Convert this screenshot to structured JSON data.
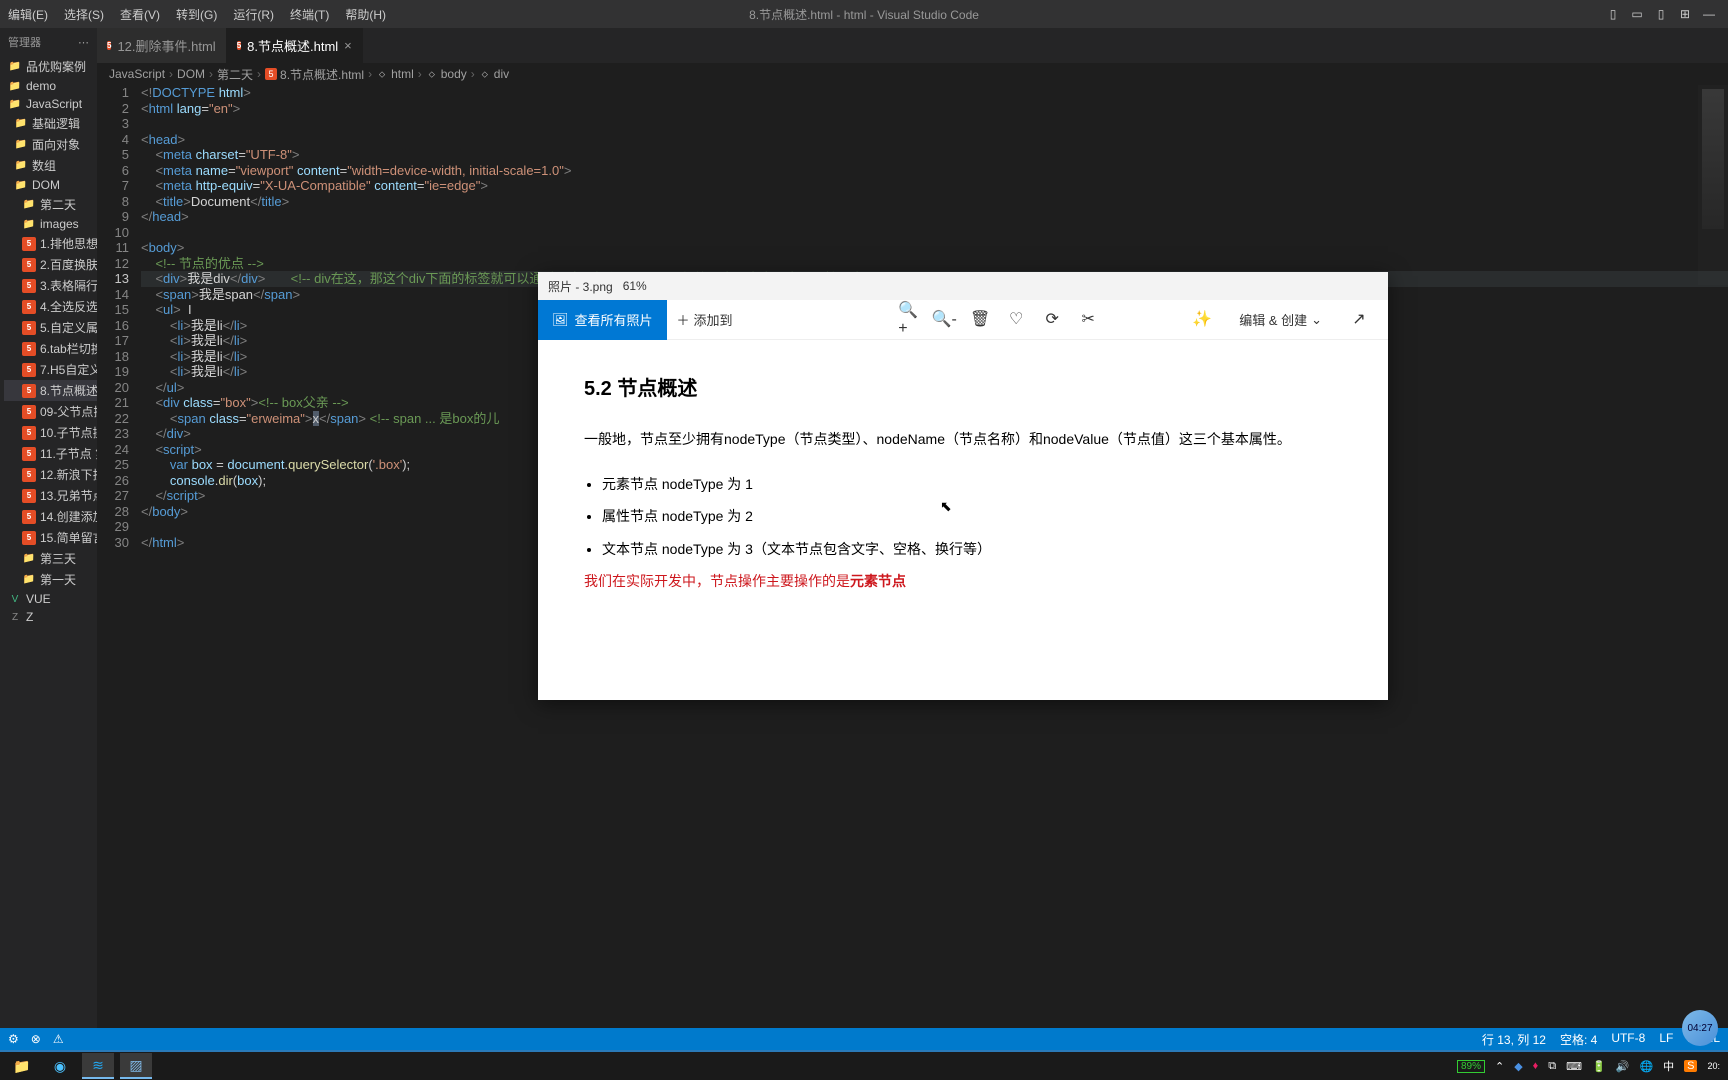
{
  "menubar": {
    "items": [
      "编辑(E)",
      "选择(S)",
      "查看(V)",
      "转到(G)",
      "运行(R)",
      "终端(T)",
      "帮助(H)"
    ],
    "title": "8.节点概述.html - html - Visual Studio Code"
  },
  "sidebar": {
    "header": "管理器",
    "items": [
      {
        "label": "品优购案例",
        "icon": "folder"
      },
      {
        "label": "demo",
        "icon": "folder"
      },
      {
        "label": "JavaScript",
        "icon": "folder"
      },
      {
        "label": "基础逻辑",
        "icon": "folder",
        "indent": 1
      },
      {
        "label": "面向对象",
        "icon": "folder",
        "indent": 1
      },
      {
        "label": "数组",
        "icon": "folder",
        "indent": 1
      },
      {
        "label": "DOM",
        "icon": "folder",
        "indent": 1
      },
      {
        "label": "第二天",
        "icon": "folder",
        "indent": 2
      },
      {
        "label": "images",
        "icon": "folder",
        "indent": 2
      },
      {
        "label": "1.排他思想.ht...",
        "icon": "html5",
        "indent": 2
      },
      {
        "label": "2.百度换肤效...",
        "icon": "html5",
        "indent": 2
      },
      {
        "label": "3.表格隔行变...",
        "icon": "html5",
        "indent": 2
      },
      {
        "label": "4.全选反选.ht...",
        "icon": "html5",
        "indent": 2
      },
      {
        "label": "5.自定义属性...",
        "icon": "html5",
        "indent": 2
      },
      {
        "label": "6.tab栏切换.h...",
        "icon": "html5",
        "indent": 2
      },
      {
        "label": "7.H5自定义属...",
        "icon": "html5",
        "indent": 2
      },
      {
        "label": "8.节点概述.ht...",
        "icon": "html5",
        "indent": 2,
        "selected": true
      },
      {
        "label": "09-父节点操...",
        "icon": "html5",
        "indent": 2
      },
      {
        "label": "10.子节点操...",
        "icon": "html5",
        "indent": 2
      },
      {
        "label": "11.子节点 第...",
        "icon": "html5",
        "indent": 2
      },
      {
        "label": "12.新浪下拉...",
        "icon": "html5",
        "indent": 2
      },
      {
        "label": "13.兄弟节点.h...",
        "icon": "html5",
        "indent": 2
      },
      {
        "label": "14.创建添加...",
        "icon": "html5",
        "indent": 2
      },
      {
        "label": "15.简单留言...",
        "icon": "html5",
        "indent": 2
      },
      {
        "label": "第三天",
        "icon": "folder",
        "indent": 2
      },
      {
        "label": "第一天",
        "icon": "folder",
        "indent": 2
      },
      {
        "label": "VUE",
        "icon": "vue"
      },
      {
        "label": "Z",
        "icon": "z"
      }
    ]
  },
  "tabs": [
    {
      "label": "12.删除事件.html"
    },
    {
      "label": "8.节点概述.html",
      "active": true
    }
  ],
  "breadcrumb": [
    "JavaScript",
    "DOM",
    "第二天",
    "8.节点概述.html",
    "html",
    "body",
    "div"
  ],
  "code": {
    "lines": [
      {
        "n": 1,
        "html": "<span class='t-punc'>&lt;!</span><span class='t-tag'>DOCTYPE</span> <span class='t-attr'>html</span><span class='t-punc'>&gt;</span>"
      },
      {
        "n": 2,
        "html": "<span class='t-punc'>&lt;</span><span class='t-tag'>html</span> <span class='t-attr'>lang</span>=<span class='t-str'>\"en\"</span><span class='t-punc'>&gt;</span>"
      },
      {
        "n": 3,
        "html": ""
      },
      {
        "n": 4,
        "html": "<span class='t-punc'>&lt;</span><span class='t-tag'>head</span><span class='t-punc'>&gt;</span>"
      },
      {
        "n": 5,
        "html": "    <span class='t-punc'>&lt;</span><span class='t-tag'>meta</span> <span class='t-attr'>charset</span>=<span class='t-str'>\"UTF-8\"</span><span class='t-punc'>&gt;</span>"
      },
      {
        "n": 6,
        "html": "    <span class='t-punc'>&lt;</span><span class='t-tag'>meta</span> <span class='t-attr'>name</span>=<span class='t-str'>\"viewport\"</span> <span class='t-attr'>content</span>=<span class='t-str'>\"width=device-width, initial-scale=1.0\"</span><span class='t-punc'>&gt;</span>"
      },
      {
        "n": 7,
        "html": "    <span class='t-punc'>&lt;</span><span class='t-tag'>meta</span> <span class='t-attr'>http-equiv</span>=<span class='t-str'>\"X-UA-Compatible\"</span> <span class='t-attr'>content</span>=<span class='t-str'>\"ie=edge\"</span><span class='t-punc'>&gt;</span>"
      },
      {
        "n": 8,
        "html": "    <span class='t-punc'>&lt;</span><span class='t-tag'>title</span><span class='t-punc'>&gt;</span><span class='t-text'>Document</span><span class='t-punc'>&lt;/</span><span class='t-tag'>title</span><span class='t-punc'>&gt;</span>"
      },
      {
        "n": 9,
        "html": "<span class='t-punc'>&lt;/</span><span class='t-tag'>head</span><span class='t-punc'>&gt;</span>"
      },
      {
        "n": 10,
        "html": ""
      },
      {
        "n": 11,
        "html": "<span class='t-punc'>&lt;</span><span class='t-tag'>body</span><span class='t-punc'>&gt;</span>"
      },
      {
        "n": 12,
        "html": "    <span class='t-cmt'>&lt;!-- 节点的优点 --&gt;</span>"
      },
      {
        "n": 13,
        "hl": true,
        "html": "    <span class='t-punc'>&lt;</span><span class='t-tag'>div</span><span class='t-punc'>&gt;</span><span class='t-text'>我是div</span><span class='t-punc'>&lt;/</span><span class='t-tag'>div</span><span class='t-punc'>&gt;</span>       <span class='t-cmt'>&lt;!-- div在这，那这个div下面的标签就可以通过节点来操作 --&gt;</span>      <span class='t-cmt'>&lt;!--标签节点、文本节点、属性节点--&gt;</span>"
      },
      {
        "n": 14,
        "html": "    <span class='t-punc'>&lt;</span><span class='t-tag'>span</span><span class='t-punc'>&gt;</span><span class='t-text'>我是span</span><span class='t-punc'>&lt;/</span><span class='t-tag'>span</span><span class='t-punc'>&gt;</span>"
      },
      {
        "n": 15,
        "html": "    <span class='t-punc'>&lt;</span><span class='t-tag'>ul</span><span class='t-punc'>&gt;</span>  <span class='t-text'>I</span>"
      },
      {
        "n": 16,
        "html": "        <span class='t-punc'>&lt;</span><span class='t-tag'>li</span><span class='t-punc'>&gt;</span><span class='t-text'>我是li</span><span class='t-punc'>&lt;/</span><span class='t-tag'>li</span><span class='t-punc'>&gt;</span>"
      },
      {
        "n": 17,
        "html": "        <span class='t-punc'>&lt;</span><span class='t-tag'>li</span><span class='t-punc'>&gt;</span><span class='t-text'>我是li</span><span class='t-punc'>&lt;/</span><span class='t-tag'>li</span><span class='t-punc'>&gt;</span>"
      },
      {
        "n": 18,
        "html": "        <span class='t-punc'>&lt;</span><span class='t-tag'>li</span><span class='t-punc'>&gt;</span><span class='t-text'>我是li</span><span class='t-punc'>&lt;/</span><span class='t-tag'>li</span><span class='t-punc'>&gt;</span>"
      },
      {
        "n": 19,
        "html": "        <span class='t-punc'>&lt;</span><span class='t-tag'>li</span><span class='t-punc'>&gt;</span><span class='t-text'>我是li</span><span class='t-punc'>&lt;/</span><span class='t-tag'>li</span><span class='t-punc'>&gt;</span>"
      },
      {
        "n": 20,
        "html": "    <span class='t-punc'>&lt;/</span><span class='t-tag'>ul</span><span class='t-punc'>&gt;</span>"
      },
      {
        "n": 21,
        "html": "    <span class='t-punc'>&lt;</span><span class='t-tag'>div</span> <span class='t-attr'>class</span>=<span class='t-str'>\"box\"</span><span class='t-punc'>&gt;</span><span class='t-cmt'>&lt;!-- box父亲 --&gt;</span>"
      },
      {
        "n": 22,
        "html": "        <span class='t-punc'>&lt;</span><span class='t-tag'>span</span> <span class='t-attr'>class</span>=<span class='t-str'>\"erweima\"</span><span class='t-punc'>&gt;</span><span class='cursor-mark'>x</span><span class='t-punc'>&lt;/</span><span class='t-tag'>span</span><span class='t-punc'>&gt;</span> <span class='t-cmt'>&lt;!-- span ... 是box的儿</span>"
      },
      {
        "n": 23,
        "html": "    <span class='t-punc'>&lt;/</span><span class='t-tag'>div</span><span class='t-punc'>&gt;</span>"
      },
      {
        "n": 24,
        "html": "    <span class='t-punc'>&lt;</span><span class='t-tag'>script</span><span class='t-punc'>&gt;</span>"
      },
      {
        "n": 25,
        "html": "        <span class='t-kw'>var</span> <span class='t-var'>box</span> = <span class='t-var'>document</span>.<span class='t-fn'>querySelector</span>(<span class='t-str'>'.box'</span>);"
      },
      {
        "n": 26,
        "html": "        <span class='t-var'>console</span>.<span class='t-fn'>dir</span>(<span class='t-var'>box</span>);"
      },
      {
        "n": 27,
        "html": "    <span class='t-punc'>&lt;/</span><span class='t-tag'>script</span><span class='t-punc'>&gt;</span>"
      },
      {
        "n": 28,
        "html": "<span class='t-punc'>&lt;/</span><span class='t-tag'>body</span><span class='t-punc'>&gt;</span>"
      },
      {
        "n": 29,
        "html": ""
      },
      {
        "n": 30,
        "html": "<span class='t-punc'>&lt;/</span><span class='t-tag'>html</span><span class='t-punc'>&gt;</span>"
      }
    ]
  },
  "photos": {
    "title": "照片 - 3.png",
    "zoom": "61%",
    "see_all": "查看所有照片",
    "add_to": "添加到",
    "edit_create": "编辑 & 创建",
    "heading": "5.2 节点概述",
    "para": "一般地，节点至少拥有nodeType（节点类型）、nodeName（节点名称）和nodeValue（节点值）这三个基本属性。",
    "bullets": [
      "元素节点 nodeType 为 1",
      "属性节点 nodeType 为 2",
      "文本节点 nodeType 为 3（文本节点包含文字、空格、换行等）"
    ],
    "red_prefix": "我们在实际开发中，节点操作主要操作的是",
    "red_bold": "元素节点"
  },
  "status": {
    "left_icons": [
      "⊗",
      "⚠"
    ],
    "pos": "行 13, 列 12",
    "spaces": "空格: 4",
    "encoding": "UTF-8",
    "eol": "LF",
    "lang": "HTML",
    "bubble": "04:27"
  },
  "taskbar": {
    "battery": "89%",
    "ime": "中",
    "sogou": "S"
  }
}
